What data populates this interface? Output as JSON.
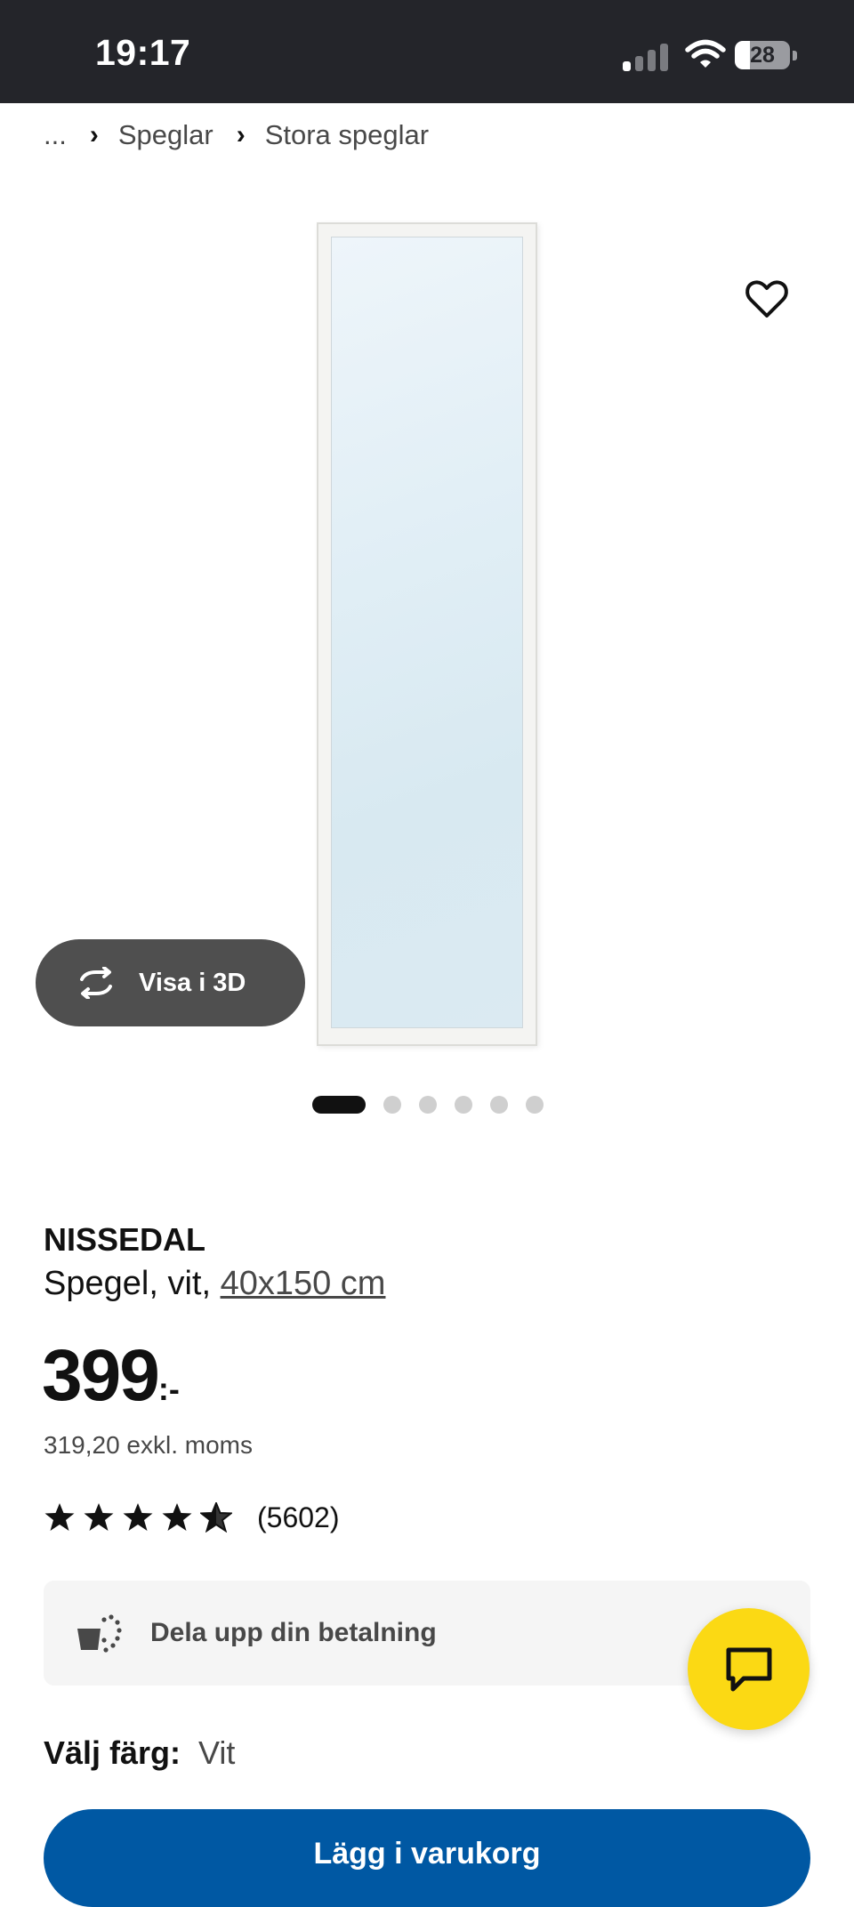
{
  "status_bar": {
    "time": "19:17",
    "battery_level": "28",
    "battery_fraction": 0.28,
    "signal_bars_active": 1,
    "icons": [
      "cellular-signal-icon",
      "wifi-icon",
      "battery-icon"
    ]
  },
  "breadcrumb": {
    "ellipsis": "...",
    "items": [
      "Speglar",
      "Stora speglar"
    ],
    "separator_icon": "chevron-right-icon"
  },
  "gallery": {
    "image_count": 6,
    "active_index": 0,
    "wishlist_icon": "heart-outline-icon",
    "view3d_label": "Visa i 3D",
    "view3d_icon": "rotate-3d-icon"
  },
  "product": {
    "name": "NISSEDAL",
    "description_prefix": "Spegel, vit, ",
    "size_link": "40x150 cm",
    "price": "399",
    "price_suffix": ":-",
    "price_ex_vat": "319,20 exkl. moms",
    "rating_stars": 4.5,
    "review_count": "(5602)"
  },
  "installment": {
    "label": "Dela upp din betalning",
    "icon": "split-payment-icon"
  },
  "chat": {
    "icon": "chat-bubble-icon"
  },
  "color": {
    "label": "Välj färg:",
    "value": "Vit"
  },
  "cta": {
    "label": "Lägg i varukorg"
  },
  "colors": {
    "status_bar_bg": "#24252a",
    "accent_yellow": "#fbd914",
    "primary_blue": "#0058a3",
    "view3d_bg": "#4f4f4f"
  }
}
